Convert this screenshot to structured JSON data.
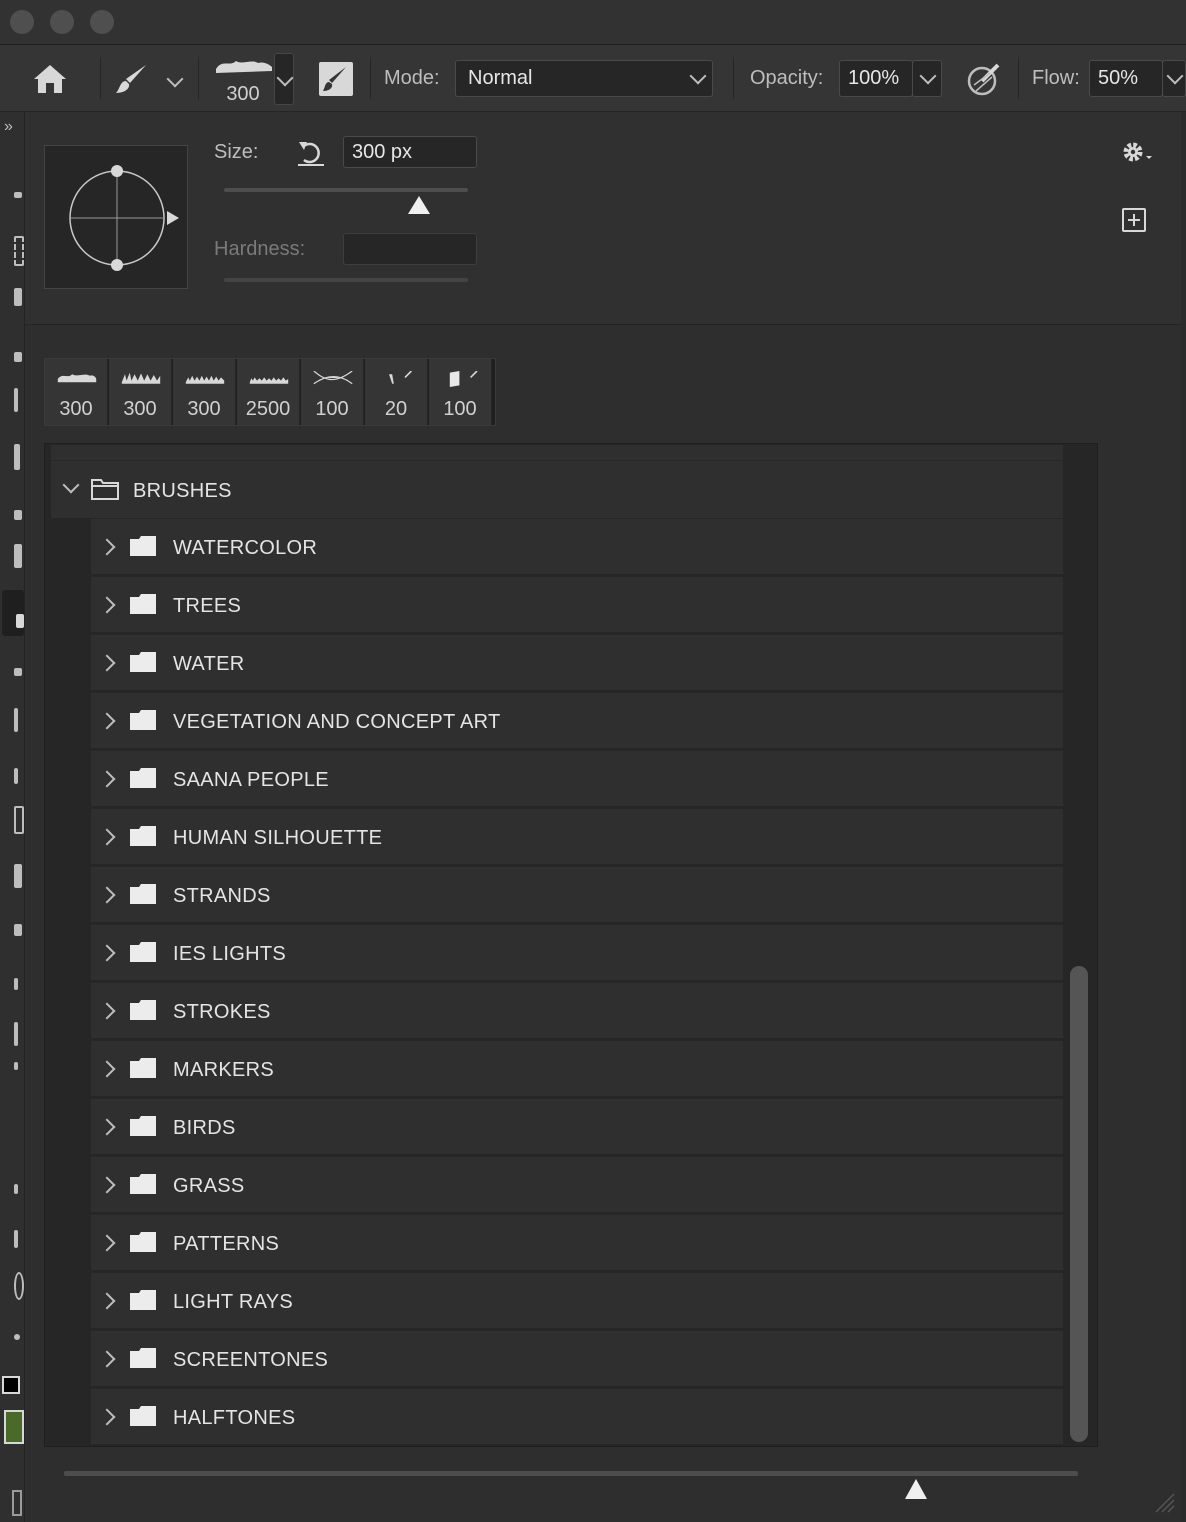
{
  "options": {
    "brush_size_badge": "300",
    "mode_label": "Mode:",
    "mode_value": "Normal",
    "opacity_label": "Opacity:",
    "opacity_value": "100%",
    "flow_label": "Flow:",
    "flow_value": "50%"
  },
  "brush_panel": {
    "size_label": "Size:",
    "size_value": "300 px",
    "size_level": 0.8,
    "hardness_label": "Hardness:",
    "hardness_value": "",
    "presets": [
      "300",
      "300",
      "300",
      "2500",
      "100",
      "20",
      "100"
    ],
    "root_folder": "BRUSHES",
    "folders": [
      "WATERCOLOR",
      "TREES",
      "WATER",
      "VEGETATION AND CONCEPT ART",
      "SAANA PEOPLE",
      "HUMAN SILHOUETTE",
      "STRANDS",
      "IES LIGHTS",
      "STROKES",
      "MARKERS",
      "BIRDS",
      "GRASS",
      "PATTERNS",
      "LIGHT RAYS",
      "SCREENTONES",
      "HALFTONES"
    ],
    "preview_size_level": 0.84
  },
  "colors": {
    "foreground": "#000000",
    "swatch": "#4a6a2a",
    "accent_bg": "#2b2b2b"
  },
  "icons": {
    "home": "home-icon",
    "brush": "brush-icon",
    "settings": "gear-icon",
    "new_preset": "new-preset-icon",
    "folder": "folder-icon"
  }
}
